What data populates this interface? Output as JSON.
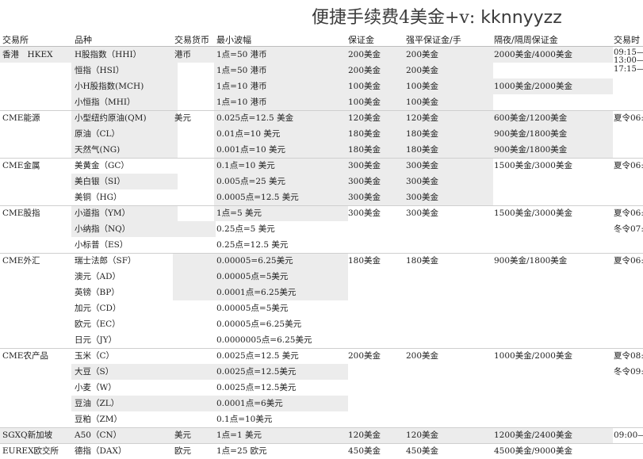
{
  "title": {
    "prefix": "便捷手续费4美金+v: ",
    "handle": "kknnyyzz"
  },
  "headers": [
    "交易所",
    "品种",
    "交易货币",
    "最小波幅",
    "保证金",
    "强平保证金/手",
    "隔夜/隔周保证金",
    "交易时"
  ],
  "rows": [
    {
      "exchange": "香港　HKEX",
      "product": "H股指数（HHI）",
      "currency": "港币",
      "tick": "1点=50 港币",
      "margin": "200美金",
      "liq": "200美金",
      "overnight": "2000美金/4000美金",
      "session": ""
    },
    {
      "exchange": "",
      "product": "恒指（HSI）",
      "currency": "",
      "tick": "1点=50 港币",
      "margin": "200美金",
      "liq": "200美金",
      "overnight": "",
      "session": ""
    },
    {
      "exchange": "",
      "product": "小H股指数(MCH)",
      "currency": "",
      "tick": "1点=10 港币",
      "margin": "100美金",
      "liq": "100美金",
      "overnight": "1000美金/2000美金",
      "session": ""
    },
    {
      "exchange": "",
      "product": "小恒指（MHI）",
      "currency": "",
      "tick": "1点=10 港币",
      "margin": "100美金",
      "liq": "100美金",
      "overnight": "",
      "session": ""
    },
    {
      "exchange": "CME能源",
      "product": "小型纽约原油(QM)",
      "currency": "美元",
      "tick": "0.025点=12.5 美金",
      "margin": "120美金",
      "liq": "120美金",
      "overnight": "600美金/1200美金",
      "session": "夏令06:"
    },
    {
      "exchange": "",
      "product": "原油（CL）",
      "currency": "",
      "tick": "0.01点=10 美元",
      "margin": "180美金",
      "liq": "180美金",
      "overnight": "900美金/1800美金",
      "session": ""
    },
    {
      "exchange": "",
      "product": "天然气(NG)",
      "currency": "",
      "tick": "0.001点=10 美元",
      "margin": "180美金",
      "liq": "180美金",
      "overnight": "900美金/1800美金",
      "session": ""
    },
    {
      "exchange": "CME金属",
      "product": "美黄金（GC）",
      "currency": "",
      "tick": "0.1点=10 美元",
      "margin": "300美金",
      "liq": "300美金",
      "overnight": "1500美金/3000美金",
      "session": "夏令06:"
    },
    {
      "exchange": "",
      "product": "美白银（SI）",
      "currency": "",
      "tick": "0.005点=25 美元",
      "margin": "300美金",
      "liq": "300美金",
      "overnight": "",
      "session": ""
    },
    {
      "exchange": "",
      "product": "美铜（HG）",
      "currency": "",
      "tick": "0.0005点=12.5 美元",
      "margin": "300美金",
      "liq": "300美金",
      "overnight": "",
      "session": ""
    },
    {
      "exchange": "CME股指",
      "product": "小道指（YM）",
      "currency": "",
      "tick": "1点=5 美元",
      "margin": "300美金",
      "liq": "300美金",
      "overnight": "1500美金/3000美金",
      "session": "夏令06:"
    },
    {
      "exchange": "",
      "product": "小纳指（NQ）",
      "currency": "",
      "tick": "0.25点=5 美元",
      "margin": "",
      "liq": "",
      "overnight": "",
      "session": "冬令07:"
    },
    {
      "exchange": "",
      "product": "小标普（ES）",
      "currency": "",
      "tick": "0.25点=12.5 美元",
      "margin": "",
      "liq": "",
      "overnight": "",
      "session": ""
    },
    {
      "exchange": "CME外汇",
      "product": "瑞士法郎（SF）",
      "currency": "",
      "tick": "0.00005=6.25美元",
      "margin": "180美金",
      "liq": "180美金",
      "overnight": "900美金/1800美金",
      "session": "夏令06:"
    },
    {
      "exchange": "",
      "product": "澳元（AD）",
      "currency": "",
      "tick": "0.00005点=5美元",
      "margin": "",
      "liq": "",
      "overnight": "",
      "session": ""
    },
    {
      "exchange": "",
      "product": "英镑（BP）",
      "currency": "",
      "tick": "0.0001点=6.25美元",
      "margin": "",
      "liq": "",
      "overnight": "",
      "session": ""
    },
    {
      "exchange": "",
      "product": "加元（CD）",
      "currency": "",
      "tick": "0.00005点=5美元",
      "margin": "",
      "liq": "",
      "overnight": "",
      "session": ""
    },
    {
      "exchange": "",
      "product": "欧元（EC）",
      "currency": "",
      "tick": "0.00005点=6.25美元",
      "margin": "",
      "liq": "",
      "overnight": "",
      "session": ""
    },
    {
      "exchange": "",
      "product": "日元（JY）",
      "currency": "",
      "tick": "0.0000005点=6.25美元",
      "margin": "",
      "liq": "",
      "overnight": "",
      "session": ""
    },
    {
      "exchange": "CME农产品",
      "product": "玉米（C）",
      "currency": "",
      "tick": "0.0025点=12.5 美元",
      "margin": "200美金",
      "liq": "200美金",
      "overnight": "1000美金/2000美金",
      "session": "夏令08:"
    },
    {
      "exchange": "",
      "product": "大豆（S）",
      "currency": "",
      "tick": "0.0025点=12.5美元",
      "margin": "",
      "liq": "",
      "overnight": "",
      "session": "冬令09:"
    },
    {
      "exchange": "",
      "product": "小麦（W）",
      "currency": "",
      "tick": "0.0025点=12.5美元",
      "margin": "",
      "liq": "",
      "overnight": "",
      "session": ""
    },
    {
      "exchange": "",
      "product": "豆油（ZL）",
      "currency": "",
      "tick": "0.0001点=6美元",
      "margin": "",
      "liq": "",
      "overnight": "",
      "session": ""
    },
    {
      "exchange": "",
      "product": "豆粕（ZM）",
      "currency": "",
      "tick": "0.1点=10美元",
      "margin": "",
      "liq": "",
      "overnight": "",
      "session": ""
    },
    {
      "exchange": "SGXQ新加坡",
      "product": "A50（CN）",
      "currency": "美元",
      "tick": "1点=1 美元",
      "margin": "120美金",
      "liq": "120美金",
      "overnight": "1200美金/2400美金",
      "session": "09:00—"
    },
    {
      "exchange": "EUREX欧交所",
      "product": "德指（DAX）",
      "currency": "欧元",
      "tick": "1点=25 欧元",
      "margin": "450美金",
      "liq": "450美金",
      "overnight": "4500美金/9000美金",
      "session": ""
    }
  ],
  "hk_sessions": [
    "09:15—",
    "13:00—",
    "17:15—"
  ]
}
